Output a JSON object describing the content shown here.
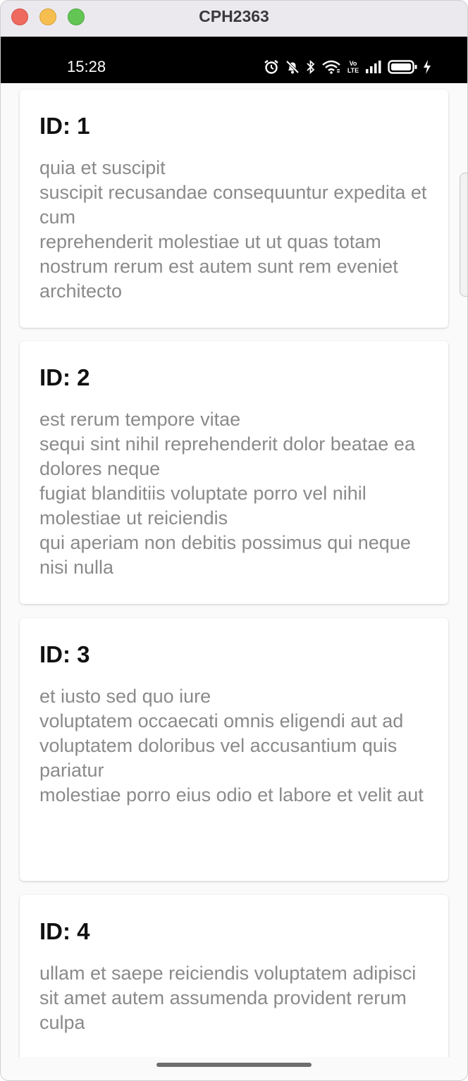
{
  "window": {
    "title": "CPH2363"
  },
  "status_bar": {
    "time": "15:28",
    "icons": [
      "alarm-icon",
      "mute-icon",
      "bluetooth-icon",
      "wifi-icon",
      "volte-icon",
      "signal-icon",
      "battery-icon",
      "charging-icon"
    ],
    "volte_top": "Vo",
    "volte_bottom": "LTE"
  },
  "colors": {
    "title_text": "#111111",
    "body_text": "#8a8a8a",
    "card_background": "#ffffff",
    "page_background": "#fafafa",
    "status_bar_background": "#000000"
  },
  "posts": [
    {
      "title": "ID: 1",
      "body": "quia et suscipit\nsuscipit recusandae consequuntur expedita et cum\nreprehenderit molestiae ut ut quas totam\nnostrum rerum est autem sunt rem eveniet architecto"
    },
    {
      "title": "ID: 2",
      "body": "est rerum tempore vitae\nsequi sint nihil reprehenderit dolor beatae ea dolores neque\nfugiat blanditiis voluptate porro vel nihil molestiae ut reiciendis\nqui aperiam non debitis possimus qui neque nisi nulla"
    },
    {
      "title": "ID: 3",
      "body": "et iusto sed quo iure\nvoluptatem occaecati omnis eligendi aut ad\nvoluptatem doloribus vel accusantium quis pariatur\nmolestiae porro eius odio et labore et velit aut"
    },
    {
      "title": "ID: 4",
      "body": "ullam et saepe reiciendis voluptatem adipisci\nsit amet autem assumenda provident rerum culpa"
    }
  ]
}
